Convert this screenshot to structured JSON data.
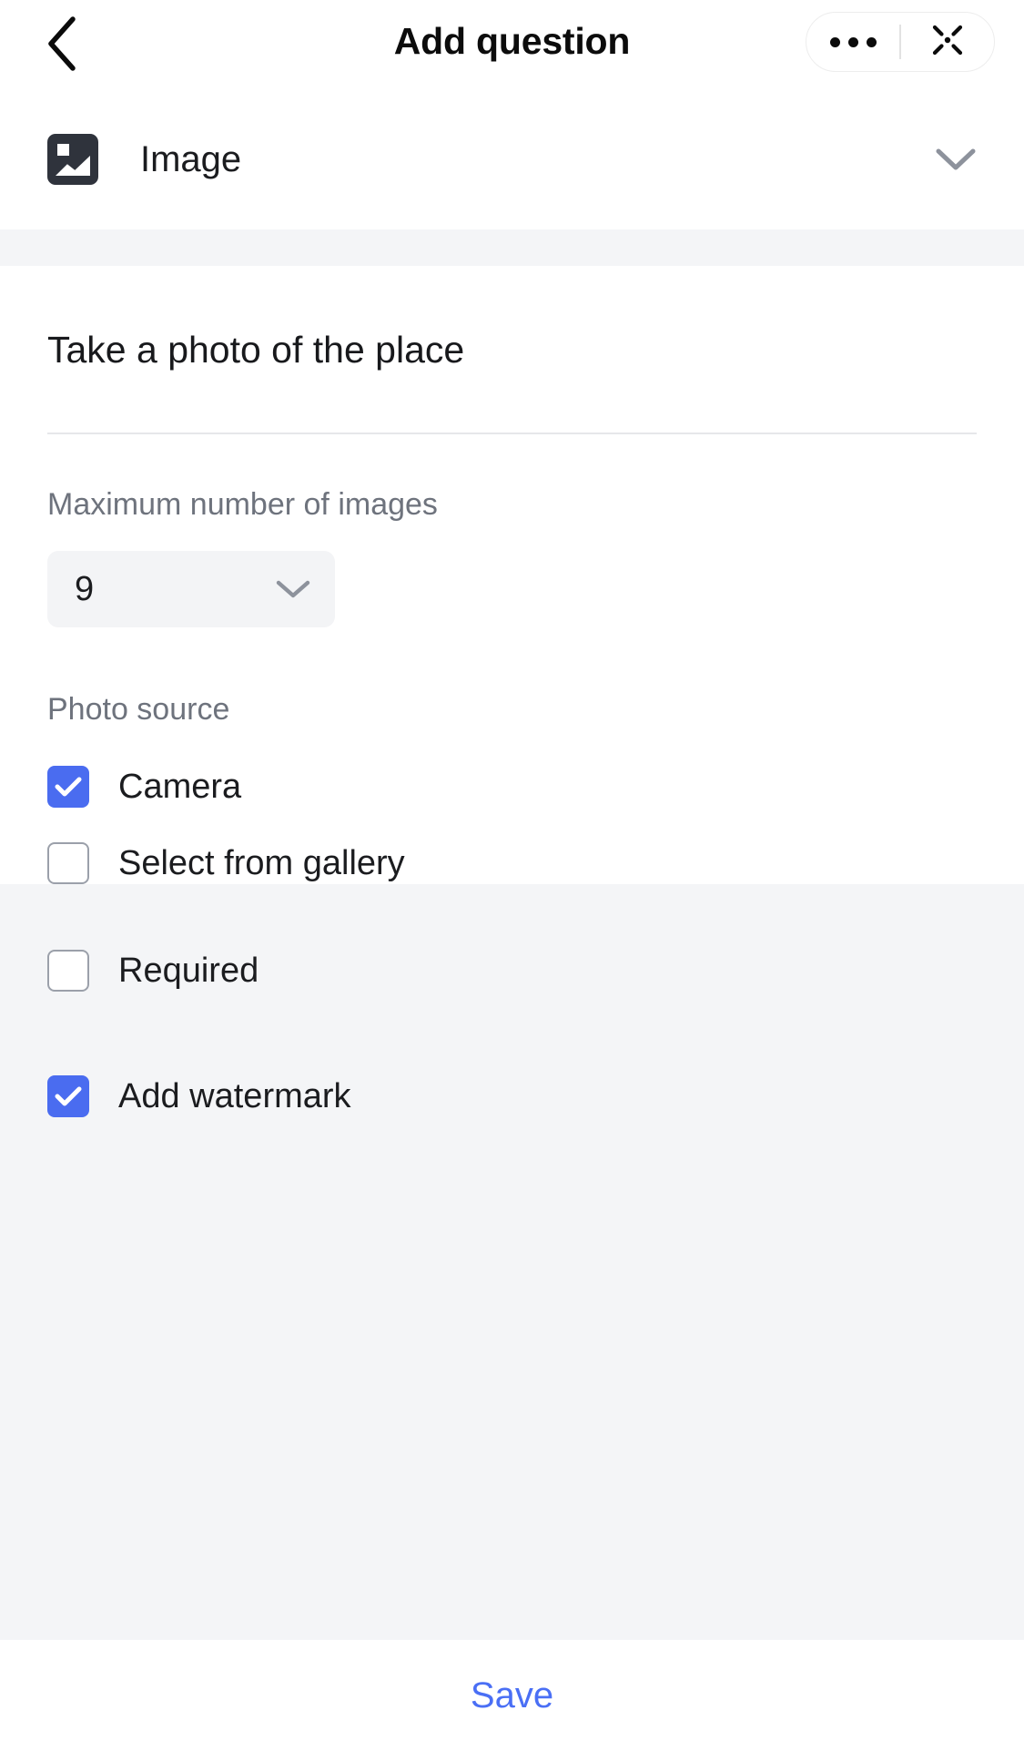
{
  "header": {
    "title": "Add question",
    "back_icon": "chevron-left-icon",
    "capsule": {
      "more_icon": "more-dots-icon",
      "close_icon": "close-target-icon"
    }
  },
  "type_row": {
    "icon": "image-icon",
    "label": "Image",
    "chevron_icon": "chevron-down-icon"
  },
  "form": {
    "question_title": "Take a photo of the place",
    "max_images": {
      "label": "Maximum number of images",
      "value": "9",
      "chevron_icon": "chevron-down-icon"
    },
    "photo_source": {
      "label": "Photo source",
      "options": [
        {
          "label": "Camera",
          "checked": true
        },
        {
          "label": "Select from gallery",
          "checked": false
        }
      ]
    },
    "settings": [
      {
        "label": "Required",
        "checked": false
      },
      {
        "label": "Add watermark",
        "checked": true
      }
    ]
  },
  "footer": {
    "save_label": "Save"
  },
  "colors": {
    "accent_blue": "#4a6cf0",
    "save_blue": "#4a6ff5",
    "section_gray": "#f4f5f7",
    "field_gray": "#f3f4f6",
    "label_gray": "#6e737d",
    "icon_dark": "#2f333c",
    "text_dark": "#1b1c1f"
  }
}
